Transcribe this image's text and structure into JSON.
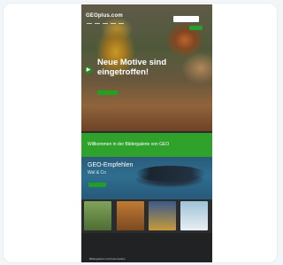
{
  "header": {
    "logo_text": "GEOplus.com"
  },
  "hero": {
    "title": "Neue Motive sind eingetroffen!"
  },
  "green_band": {
    "text": "Willkommen in der Bildergalerie von GEO"
  },
  "abo": {
    "title": "GEO-Empfehlen",
    "subtitle": "Wal & Co"
  },
  "footer": {
    "text": "Bildergalerie und Fotos kaufen"
  },
  "colors": {
    "accent_green": "#2ea22b",
    "page_dark": "#2a2c2e"
  },
  "icons": {
    "carousel_arrow": "play-icon",
    "logo": "geo-logo"
  }
}
